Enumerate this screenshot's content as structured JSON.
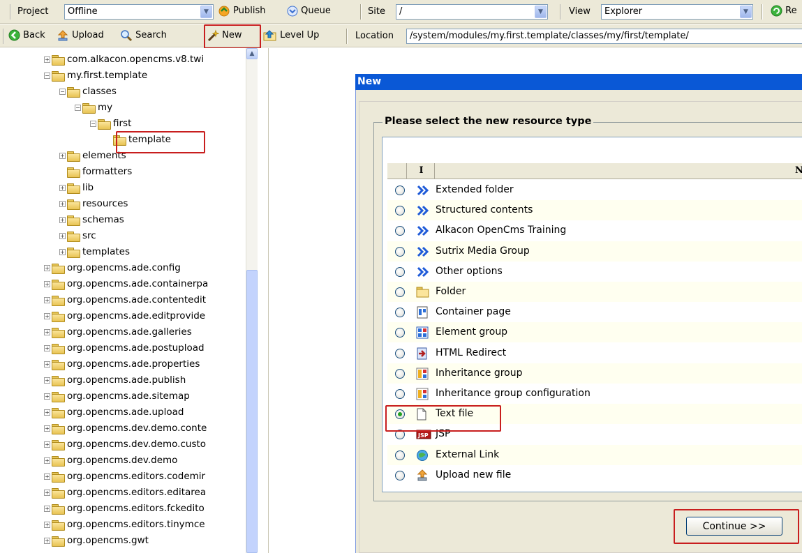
{
  "toolbar1": {
    "project_label": "Project",
    "project_value": "Offline",
    "publish_label": "Publish",
    "queue_label": "Queue",
    "site_label": "Site",
    "site_value": "/",
    "view_label": "View",
    "view_value": "Explorer",
    "reload_label": "Re"
  },
  "toolbar2": {
    "back_label": "Back",
    "upload_label": "Upload",
    "search_label": "Search",
    "new_label": "New",
    "levelup_label": "Level Up",
    "location_label": "Location",
    "location_value": "/system/modules/my.first.template/classes/my/first/template/"
  },
  "tree": {
    "items": [
      {
        "label": "com.alkacon.opencms.v8.twi"
      },
      {
        "label": "my.first.template"
      },
      {
        "label": "classes"
      },
      {
        "label": "my"
      },
      {
        "label": "first"
      },
      {
        "label": "template"
      },
      {
        "label": "elements"
      },
      {
        "label": "formatters"
      },
      {
        "label": "lib"
      },
      {
        "label": "resources"
      },
      {
        "label": "schemas"
      },
      {
        "label": "src"
      },
      {
        "label": "templates"
      },
      {
        "label": "org.opencms.ade.config"
      },
      {
        "label": "org.opencms.ade.containerpa"
      },
      {
        "label": "org.opencms.ade.contentedit"
      },
      {
        "label": "org.opencms.ade.editprovide"
      },
      {
        "label": "org.opencms.ade.galleries"
      },
      {
        "label": "org.opencms.ade.postupload"
      },
      {
        "label": "org.opencms.ade.properties"
      },
      {
        "label": "org.opencms.ade.publish"
      },
      {
        "label": "org.opencms.ade.sitemap"
      },
      {
        "label": "org.opencms.ade.upload"
      },
      {
        "label": "org.opencms.dev.demo.conte"
      },
      {
        "label": "org.opencms.dev.demo.custo"
      },
      {
        "label": "org.opencms.dev.demo"
      },
      {
        "label": "org.opencms.editors.codemir"
      },
      {
        "label": "org.opencms.editors.editarea"
      },
      {
        "label": "org.opencms.editors.fckedito"
      },
      {
        "label": "org.opencms.editors.tinymce"
      },
      {
        "label": "org.opencms.gwt"
      }
    ]
  },
  "dialog": {
    "title": "New",
    "legend": "Please select the new resource type",
    "col_icon": "I",
    "col_name": "N",
    "continue_label": "Continue >>",
    "types": [
      {
        "label": "Extended folder",
        "icon": "chevron-icon"
      },
      {
        "label": "Structured contents",
        "icon": "chevron-icon"
      },
      {
        "label": "Alkacon OpenCms Training",
        "icon": "chevron-icon"
      },
      {
        "label": "Sutrix Media Group",
        "icon": "chevron-icon"
      },
      {
        "label": "Other options",
        "icon": "chevron-icon"
      },
      {
        "label": "Folder",
        "icon": "folder-icon"
      },
      {
        "label": "Container page",
        "icon": "container-page-icon"
      },
      {
        "label": "Element group",
        "icon": "element-group-icon"
      },
      {
        "label": "HTML Redirect",
        "icon": "redirect-icon"
      },
      {
        "label": "Inheritance group",
        "icon": "inheritance-icon"
      },
      {
        "label": "Inheritance group configuration",
        "icon": "inheritance-icon"
      },
      {
        "label": "Text file",
        "icon": "text-file-icon",
        "selected": true
      },
      {
        "label": "JSP",
        "icon": "jsp-icon"
      },
      {
        "label": "External Link",
        "icon": "external-link-icon"
      },
      {
        "label": "Upload new file",
        "icon": "upload-icon"
      }
    ]
  },
  "colors": {
    "accent": "#0a58d6",
    "highlight": "#c81e1e",
    "chrome": "#ece9d8"
  }
}
